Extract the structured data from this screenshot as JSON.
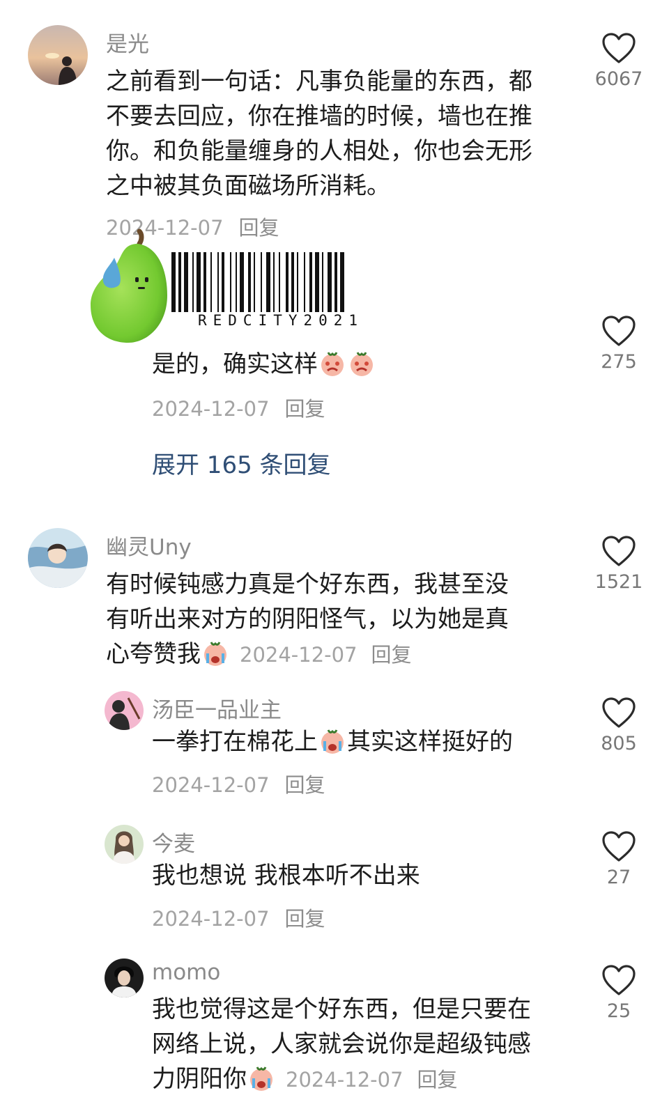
{
  "comments": [
    {
      "username": "是光",
      "text": "之前看到一句话：凡事负能量的东西，都不要去回应，你在推墙的时候，墙也在推你。和负能量缠身的人相处，你也会无形之中被其负面磁场所消耗。",
      "date": "2024-12-07",
      "reply_label": "回复",
      "likes": "6067",
      "replies": [
        {
          "username": "",
          "text": "是的，确实这样",
          "date": "2024-12-07",
          "reply_label": "回复",
          "likes": "275",
          "emojis": [
            "crying-face-emoji",
            "crying-face-emoji"
          ]
        }
      ],
      "expand_label": "展开 165 条回复"
    },
    {
      "username": "幽灵Uny",
      "text_line1": "有时候钝感力真是个好东西，我甚至没",
      "text_line2": "有听出来对方的阴阳怪气，以为她是真",
      "text_line3": "心夸赞我",
      "date": "2024-12-07",
      "reply_label": "回复",
      "likes": "1521",
      "replies": [
        {
          "username": "汤臣一品业主",
          "text_before": "一拳打在棉花上",
          "text_after": "其实这样挺好的",
          "date": "2024-12-07",
          "reply_label": "回复",
          "likes": "805"
        },
        {
          "username": "今麦",
          "text": "我也想说 我根本听不出来",
          "date": "2024-12-07",
          "reply_label": "回复",
          "likes": "27"
        },
        {
          "username": "momo",
          "text_line1": "我也觉得这是个好东西，但是只要在",
          "text_line2": "网络上说，人家就会说你是超级钝感",
          "text_line3": "力阴阳你",
          "date": "2024-12-07",
          "reply_label": "回复",
          "likes": "25"
        }
      ]
    }
  ],
  "sticker": {
    "barcode_text": "REDCITY2021",
    "icon": "pear-sticker"
  },
  "colors": {
    "link": "#2f4e75",
    "meta": "#a3a3a3",
    "username": "#8a8a8a"
  }
}
